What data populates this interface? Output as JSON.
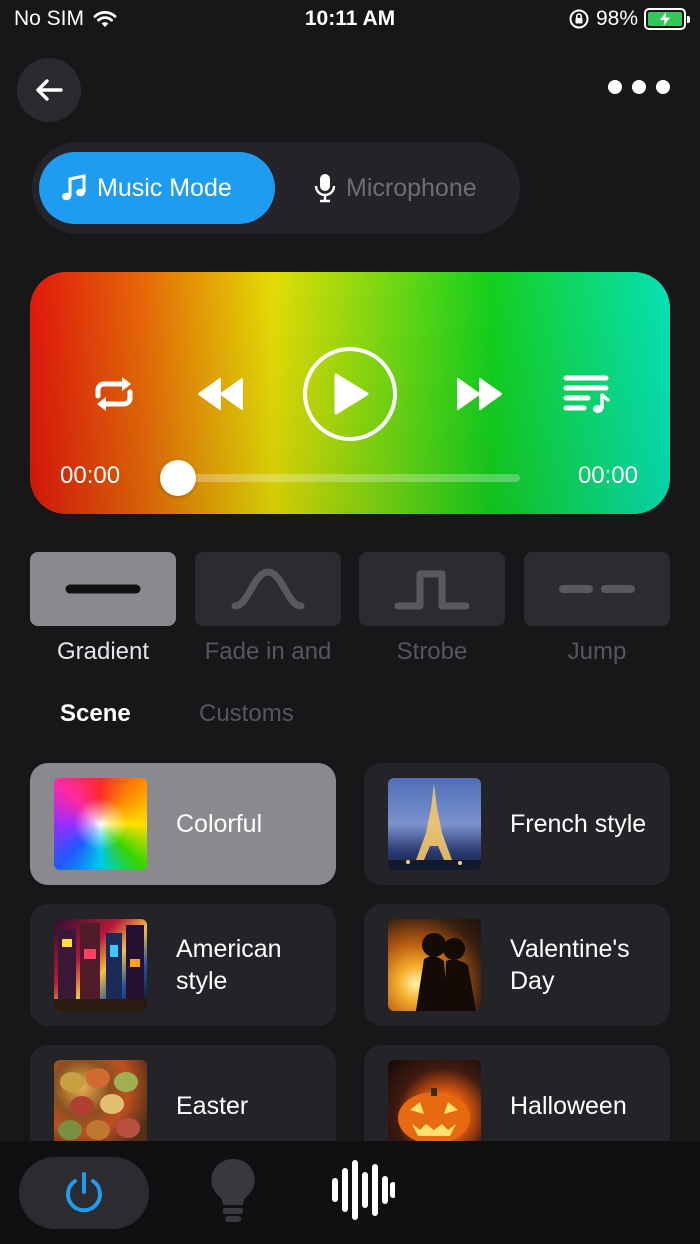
{
  "status_bar": {
    "carrier": "No SIM",
    "time": "10:11 AM",
    "battery": "98%"
  },
  "header": {
    "back_icon": "arrow-left-icon",
    "more_icon": "more-dots-icon"
  },
  "mode_toggle": {
    "options": [
      {
        "label": "Music Mode",
        "icon": "music-note-icon",
        "selected": true
      },
      {
        "label": "Microphone",
        "icon": "microphone-icon",
        "selected": false
      }
    ],
    "accent": "#1e9cf0"
  },
  "player": {
    "current_time": "00:00",
    "total_time": "00:00",
    "progress": 0,
    "controls": [
      "repeat-icon",
      "previous-icon",
      "play-icon",
      "next-icon",
      "playlist-icon"
    ]
  },
  "effects": [
    {
      "label": "Gradient",
      "icon": "flat-line-icon",
      "selected": true
    },
    {
      "label": "Fade in and",
      "icon": "curve-icon",
      "selected": false
    },
    {
      "label": "Strobe",
      "icon": "pulse-icon",
      "selected": false
    },
    {
      "label": "Jump",
      "icon": "dash-icon",
      "selected": false
    }
  ],
  "tabs": [
    {
      "label": "Scene",
      "selected": true
    },
    {
      "label": "Customs",
      "selected": false
    }
  ],
  "scenes": [
    {
      "label": "Colorful",
      "selected": true
    },
    {
      "label": "French style",
      "selected": false
    },
    {
      "label": "American style",
      "selected": false
    },
    {
      "label": "Valentine's Day",
      "selected": false
    },
    {
      "label": "Easter",
      "selected": false
    },
    {
      "label": "Halloween",
      "selected": false
    }
  ],
  "bottom_nav": [
    {
      "icon": "power-icon",
      "selected": true,
      "color": "#1e9cf0"
    },
    {
      "icon": "lightbulb-icon",
      "selected": false
    },
    {
      "icon": "sound-wave-icon",
      "selected": false
    }
  ]
}
